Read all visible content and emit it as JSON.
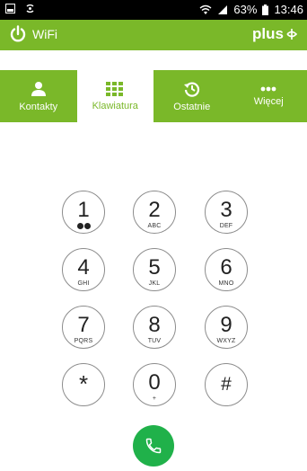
{
  "status_bar": {
    "battery": "63%",
    "time": "13:46",
    "icons": [
      "screenshot-icon",
      "sync-icon",
      "wifi-signal-icon",
      "cellular-signal-icon",
      "battery-icon"
    ]
  },
  "app_bar": {
    "wifi_label": "WiFi",
    "brand": "plus",
    "colors": {
      "accent": "#7ab829",
      "call": "#20b14a"
    }
  },
  "tabs": [
    {
      "label": "Kontakty",
      "icon": "person-icon"
    },
    {
      "label": "Klawiatura",
      "icon": "dialpad-icon",
      "active": true
    },
    {
      "label": "Ostatnie",
      "icon": "history-icon"
    },
    {
      "label": "Więcej",
      "icon": "more-dots-icon"
    }
  ],
  "keypad": {
    "keys": [
      {
        "digit": "1",
        "letters": ""
      },
      {
        "digit": "2",
        "letters": "ABC"
      },
      {
        "digit": "3",
        "letters": "DEF"
      },
      {
        "digit": "4",
        "letters": "GHI"
      },
      {
        "digit": "5",
        "letters": "JKL"
      },
      {
        "digit": "6",
        "letters": "MNO"
      },
      {
        "digit": "7",
        "letters": "PQRS"
      },
      {
        "digit": "8",
        "letters": "TUV"
      },
      {
        "digit": "9",
        "letters": "WXYZ"
      },
      {
        "digit": "*",
        "letters": ""
      },
      {
        "digit": "0",
        "letters": "+"
      },
      {
        "digit": "#",
        "letters": ""
      }
    ]
  },
  "call_button": {
    "icon": "phone-icon"
  }
}
